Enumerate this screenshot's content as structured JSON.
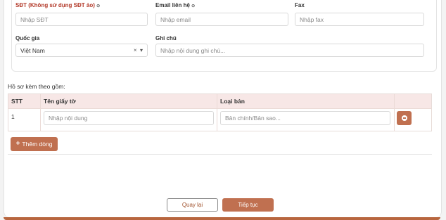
{
  "form": {
    "phone_label": "SĐT (Không sử dụng SĐT ảo)",
    "phone_placeholder": "Nhập SĐT",
    "email_label": "Email liên hệ",
    "email_placeholder": "Nhập email",
    "fax_label": "Fax",
    "fax_placeholder": "Nhập fax",
    "country_label": "Quốc gia",
    "country_value": "Việt Nam",
    "country_clear": "×",
    "country_caret": "▾",
    "note_label": "Ghi chú",
    "note_placeholder": "Nhập nội dung ghi chú..."
  },
  "docs": {
    "title": "Hồ sơ kèm theo gồm:",
    "headers": {
      "stt": "STT",
      "name": "Tên giấy tờ",
      "type": "Loại bản"
    },
    "rows": [
      {
        "stt": "1",
        "name_placeholder": "Nhập nội dung",
        "type_placeholder": "Bản chính/Bản sao..."
      }
    ],
    "add_label": "Thêm dòng",
    "add_icon": "+"
  },
  "footer": {
    "back_label": "Quay lại",
    "next_label": "Tiếp tục"
  },
  "colors": {
    "accent": "#c07050",
    "table_header_bg": "#f7e7e6",
    "required": "#b33a2a"
  }
}
